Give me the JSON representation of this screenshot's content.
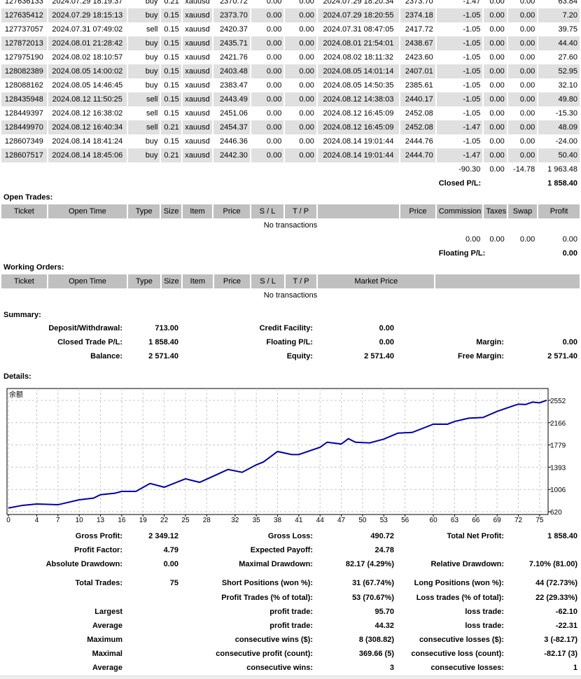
{
  "closed_trades": {
    "rows": [
      [
        "127636133",
        "2024.07.29 18:19:37",
        "buy",
        "0.21",
        "xauusd",
        "2370.72",
        "0.00",
        "0.00",
        "2024.07.29 18:20:34",
        "2373.70",
        "-1.47",
        "0.00",
        "0.00",
        "63.84"
      ],
      [
        "127635412",
        "2024.07.29 18:15:13",
        "buy",
        "0.15",
        "xauusd",
        "2373.70",
        "0.00",
        "0.00",
        "2024.07.29 18:20:55",
        "2374.18",
        "-1.05",
        "0.00",
        "0.00",
        "7.20"
      ],
      [
        "127737057",
        "2024.07.31 07:49:02",
        "sell",
        "0.15",
        "xauusd",
        "2420.37",
        "0.00",
        "0.00",
        "2024.07.31 08:47:05",
        "2417.72",
        "-1.05",
        "0.00",
        "0.00",
        "39.75"
      ],
      [
        "127872013",
        "2024.08.01 21:28:42",
        "buy",
        "0.15",
        "xauusd",
        "2435.71",
        "0.00",
        "0.00",
        "2024.08.01 21:54:01",
        "2438.67",
        "-1.05",
        "0.00",
        "0.00",
        "44.40"
      ],
      [
        "127975190",
        "2024.08.02 18:10:57",
        "buy",
        "0.15",
        "xauusd",
        "2421.76",
        "0.00",
        "0.00",
        "2024.08.02 18:11:32",
        "2423.60",
        "-1.05",
        "0.00",
        "0.00",
        "27.60"
      ],
      [
        "128082389",
        "2024.08.05 14:00:02",
        "buy",
        "0.15",
        "xauusd",
        "2403.48",
        "0.00",
        "0.00",
        "2024.08.05 14:01:14",
        "2407.01",
        "-1.05",
        "0.00",
        "0.00",
        "52.95"
      ],
      [
        "128088162",
        "2024.08.05 14:46:45",
        "buy",
        "0.15",
        "xauusd",
        "2383.47",
        "0.00",
        "0.00",
        "2024.08.05 14:50:35",
        "2385.61",
        "-1.05",
        "0.00",
        "0.00",
        "32.10"
      ],
      [
        "128435948",
        "2024.08.12 11:50:25",
        "sell",
        "0.15",
        "xauusd",
        "2443.49",
        "0.00",
        "0.00",
        "2024.08.12 14:38:03",
        "2440.17",
        "-1.05",
        "0.00",
        "0.00",
        "49.80"
      ],
      [
        "128449397",
        "2024.08.12 16:38:02",
        "sell",
        "0.15",
        "xauusd",
        "2451.06",
        "0.00",
        "0.00",
        "2024.08.12 16:45:09",
        "2452.08",
        "-1.05",
        "0.00",
        "0.00",
        "-15.30"
      ],
      [
        "128449970",
        "2024.08.12 16:40:34",
        "sell",
        "0.21",
        "xauusd",
        "2454.37",
        "0.00",
        "0.00",
        "2024.08.12 16:45:09",
        "2452.08",
        "-1.47",
        "0.00",
        "0.00",
        "48.09"
      ],
      [
        "128607349",
        "2024.08.14 18:41:24",
        "buy",
        "0.15",
        "xauusd",
        "2446.36",
        "0.00",
        "0.00",
        "2024.08.14 19:01:44",
        "2444.76",
        "-1.05",
        "0.00",
        "0.00",
        "-24.00"
      ],
      [
        "128607517",
        "2024.08.14 18:45:06",
        "buy",
        "0.21",
        "xauusd",
        "2442.30",
        "0.00",
        "0.00",
        "2024.08.14 19:01:44",
        "2444.70",
        "-1.47",
        "0.00",
        "0.00",
        "50.40"
      ]
    ],
    "totals": {
      "commission": "-90.30",
      "taxes": "0.00",
      "swap": "-14.78",
      "profit": "1 963.48"
    },
    "closed_pl_label": "Closed P/L:",
    "closed_pl": "1 858.40"
  },
  "open_trades": {
    "title": "Open Trades:",
    "headers": [
      "Ticket",
      "Open Time",
      "Type",
      "Size",
      "Item",
      "Price",
      "S / L",
      "T / P",
      "",
      "Price",
      "Commission",
      "Taxes",
      "Swap",
      "Profit"
    ],
    "empty": "No transactions",
    "totals": {
      "commission": "0.00",
      "taxes": "0.00",
      "swap": "0.00",
      "profit": "0.00"
    },
    "floating_label": "Floating P/L:",
    "floating": "0.00"
  },
  "working_orders": {
    "title": "Working Orders:",
    "headers": [
      "Ticket",
      "Open Time",
      "Type",
      "Size",
      "Item",
      "Price",
      "S / L",
      "T / P",
      "Market Price",
      ""
    ],
    "empty": "No transactions"
  },
  "summary": {
    "title": "Summary:",
    "items": [
      {
        "label": "Deposit/Withdrawal:",
        "value": "713.00"
      },
      {
        "label": "Credit Facility:",
        "value": "0.00"
      },
      {
        "label": "",
        "value": ""
      },
      {
        "label": "Closed Trade P/L:",
        "value": "1 858.40"
      },
      {
        "label": "Floating P/L:",
        "value": "0.00"
      },
      {
        "label": "Margin:",
        "value": "0.00"
      },
      {
        "label": "Balance:",
        "value": "2 571.40"
      },
      {
        "label": "Equity:",
        "value": "2 571.40"
      },
      {
        "label": "Free Margin:",
        "value": "2 571.40"
      }
    ]
  },
  "details": {
    "title": "Details:"
  },
  "chart_data": {
    "type": "line",
    "title": "余额",
    "legend": "top-left",
    "grid": true,
    "line_color": "#0000aa",
    "x_ticks": [
      0,
      4,
      7,
      10,
      13,
      16,
      19,
      22,
      25,
      28,
      32,
      35,
      38,
      41,
      44,
      47,
      50,
      53,
      56,
      60,
      63,
      66,
      69,
      72,
      75
    ],
    "y_ticks": [
      620,
      1006,
      1393,
      1779,
      2166,
      2552
    ],
    "ylim": [
      620,
      2552
    ],
    "xlim": [
      0,
      76
    ],
    "x": [
      0,
      2,
      4,
      7,
      10,
      12,
      13,
      15,
      16,
      18,
      20,
      22,
      25,
      27,
      29,
      31,
      33,
      35,
      36,
      38,
      40,
      41,
      44,
      45,
      47,
      48,
      49,
      51,
      53,
      55,
      57,
      60,
      62,
      63,
      65,
      67,
      69,
      71,
      72,
      73,
      74,
      75,
      76
    ],
    "y": [
      684,
      730,
      754,
      741,
      827,
      855,
      915,
      940,
      972,
      972,
      1110,
      1045,
      1191,
      1130,
      1240,
      1353,
      1304,
      1434,
      1483,
      1665,
      1612,
      1612,
      1738,
      1826,
      1795,
      1887,
      1826,
      1814,
      1880,
      1984,
      1996,
      2139,
      2139,
      2187,
      2244,
      2256,
      2361,
      2446,
      2487,
      2480,
      2523,
      2510,
      2555
    ]
  },
  "stats": {
    "rows": [
      [
        "Gross Profit:",
        "2 349.12",
        "Gross Loss:",
        "490.72",
        "Total Net Profit:",
        "1 858.40"
      ],
      [
        "Profit Factor:",
        "4.79",
        "Expected Payoff:",
        "24.78",
        "",
        ""
      ],
      [
        "Absolute Drawdown:",
        "0.00",
        "Maximal Drawdown:",
        "82.17 (4.29%)",
        "Relative Drawdown:",
        "7.10% (81.00)"
      ],
      [
        "Total Trades:",
        "75",
        "Short Positions (won %):",
        "31 (67.74%)",
        "Long Positions (won %):",
        "44 (72.73%)"
      ],
      [
        "",
        "",
        "Profit Trades (% of total):",
        "53 (70.67%)",
        "Loss trades (% of total):",
        "22 (29.33%)"
      ],
      [
        "Largest",
        "",
        "profit trade:",
        "95.70",
        "loss trade:",
        "-62.10"
      ],
      [
        "Average",
        "",
        "profit trade:",
        "44.32",
        "loss trade:",
        "-22.31"
      ],
      [
        "Maximum",
        "",
        "consecutive wins ($):",
        "8 (308.82)",
        "consecutive losses ($):",
        "3 (-82.17)"
      ],
      [
        "Maximal",
        "",
        "consecutive profit (count):",
        "369.66 (5)",
        "consecutive loss (count):",
        "-82.17 (3)"
      ],
      [
        "Average",
        "",
        "consecutive wins:",
        "3",
        "consecutive losses:",
        "1"
      ]
    ]
  }
}
